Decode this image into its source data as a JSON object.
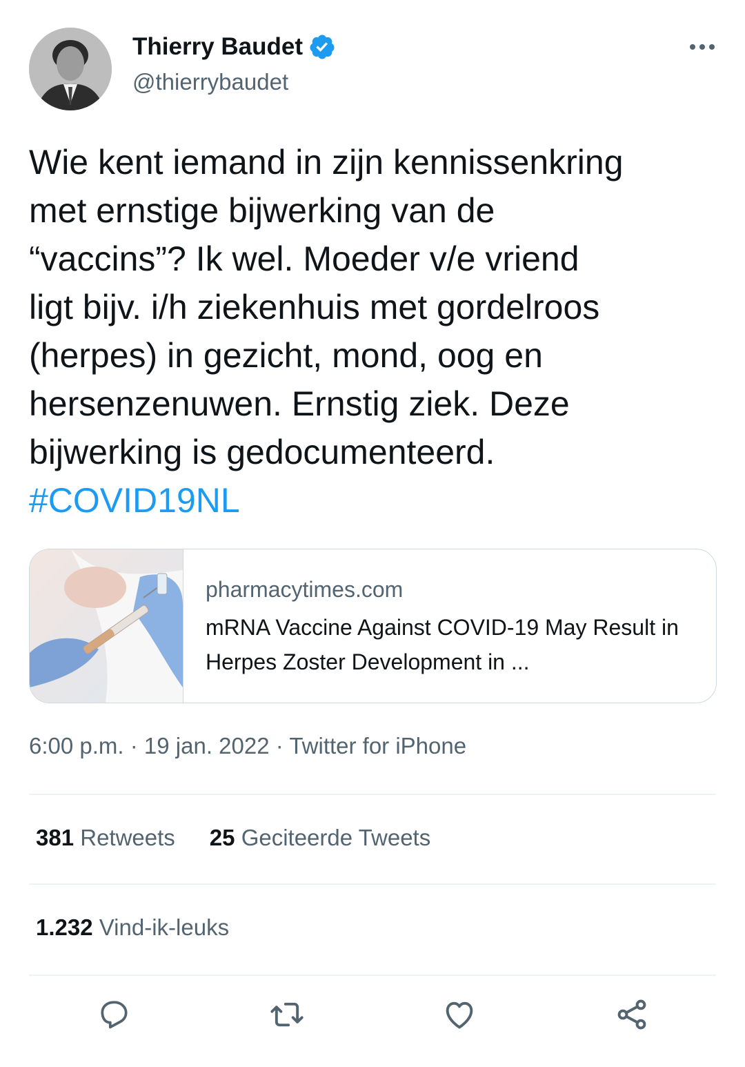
{
  "user": {
    "display_name": "Thierry Baudet",
    "handle": "@thierrybaudet",
    "verified": true
  },
  "tweet": {
    "text": "Wie kent iemand in zijn kennissenkring\nmet ernstige bijwerking van de\n“vaccins”? Ik wel. Moeder v/e vriend\nligt bijv. i/h ziekenhuis met gordelroos\n(herpes) in gezicht, mond, oog en\nhersenzenuwen. Ernstig ziek. Deze\nbijwerking is gedocumenteerd.",
    "hashtag": "#COVID19NL"
  },
  "card": {
    "domain": "pharmacytimes.com",
    "title": "mRNA Vaccine Against COVID-19 May Result in Herpes Zoster Development in ..."
  },
  "meta": {
    "time": "6:00 p.m.",
    "separator1": " · ",
    "date": "19 jan. 2022",
    "separator2": " · ",
    "source": "Twitter for iPhone"
  },
  "stats": {
    "retweets_count": "381",
    "retweets_label": "Retweets",
    "quotes_count": "25",
    "quotes_label": "Geciteerde Tweets",
    "likes_count": "1.232",
    "likes_label": "Vind-ik-leuks"
  },
  "colors": {
    "accent": "#1d9bf0",
    "text": "#0f1419",
    "secondary": "#536471",
    "border": "#cfd9de"
  },
  "icons": {
    "more": "more-horizontal-icon",
    "verified": "verified-badge-icon",
    "reply": "reply-icon",
    "retweet": "retweet-icon",
    "like": "heart-icon",
    "share": "share-icon"
  }
}
